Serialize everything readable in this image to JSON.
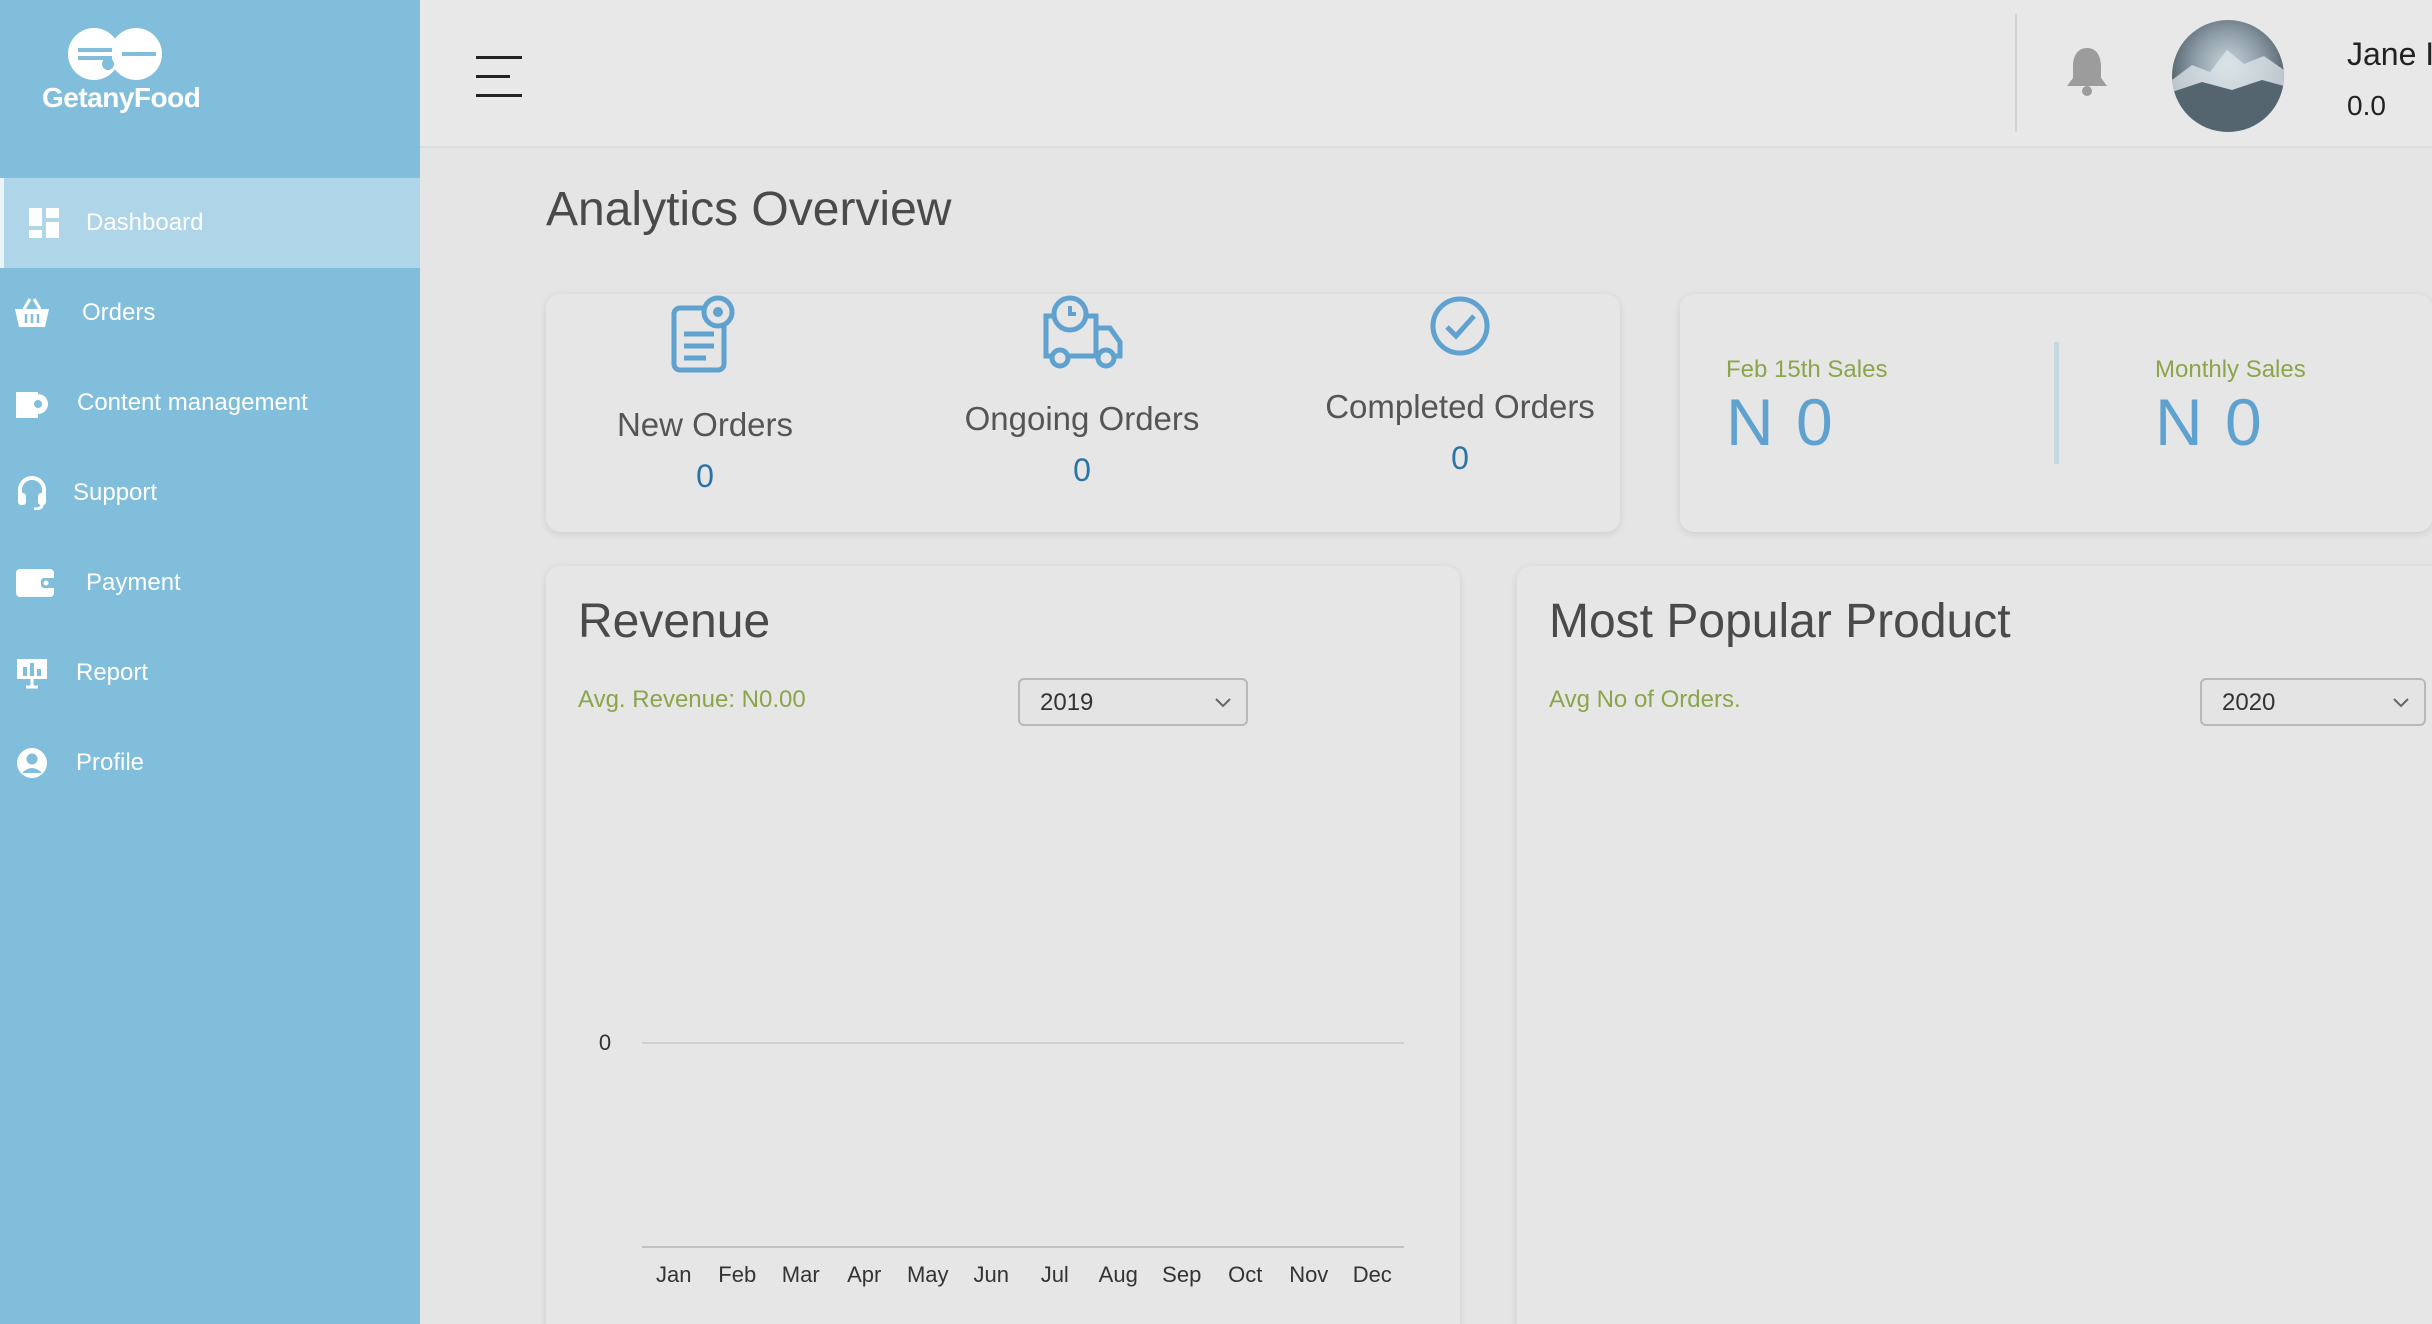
{
  "brand": {
    "name": "GetanyFood"
  },
  "sidebar": {
    "items": [
      {
        "label": "Dashboard",
        "icon": "dashboard-icon",
        "active": true
      },
      {
        "label": "Orders",
        "icon": "basket-icon"
      },
      {
        "label": "Content management",
        "icon": "content-icon"
      },
      {
        "label": "Support",
        "icon": "headset-icon"
      },
      {
        "label": "Payment",
        "icon": "wallet-icon"
      },
      {
        "label": "Report",
        "icon": "report-icon"
      },
      {
        "label": "Profile",
        "icon": "user-circle-icon"
      }
    ]
  },
  "topbar": {
    "user_name": "Jane I",
    "user_balance": "0.0"
  },
  "main": {
    "title": "Analytics Overview",
    "stats": [
      {
        "label": "New Orders",
        "value": "0",
        "icon": "new-orders-icon"
      },
      {
        "label": "Ongoing Orders",
        "value": "0",
        "icon": "delivery-truck-icon"
      },
      {
        "label": "Completed Orders",
        "value": "0",
        "icon": "check-circle-icon"
      }
    ],
    "sales": [
      {
        "label": "Feb 15th Sales",
        "value": "N 0"
      },
      {
        "label": "Monthly Sales",
        "value": "N 0"
      }
    ],
    "revenue": {
      "title": "Revenue",
      "subtitle": "Avg. Revenue: N0.00",
      "year": "2019"
    },
    "popular": {
      "title": "Most Popular Product",
      "subtitle": "Avg No of Orders.",
      "year": "2020"
    }
  },
  "chart_data": {
    "type": "line",
    "categories": [
      "Jan",
      "Feb",
      "Mar",
      "Apr",
      "May",
      "Jun",
      "Jul",
      "Aug",
      "Sep",
      "Oct",
      "Nov",
      "Dec"
    ],
    "y_ticks": [
      "0"
    ],
    "series": [],
    "grid": true,
    "legend": "none"
  },
  "colors": {
    "sidebar": "#80bedb",
    "active_item": "#aed5e8",
    "accent_blue": "#5fa1cf",
    "label_green": "#8aa64a"
  }
}
